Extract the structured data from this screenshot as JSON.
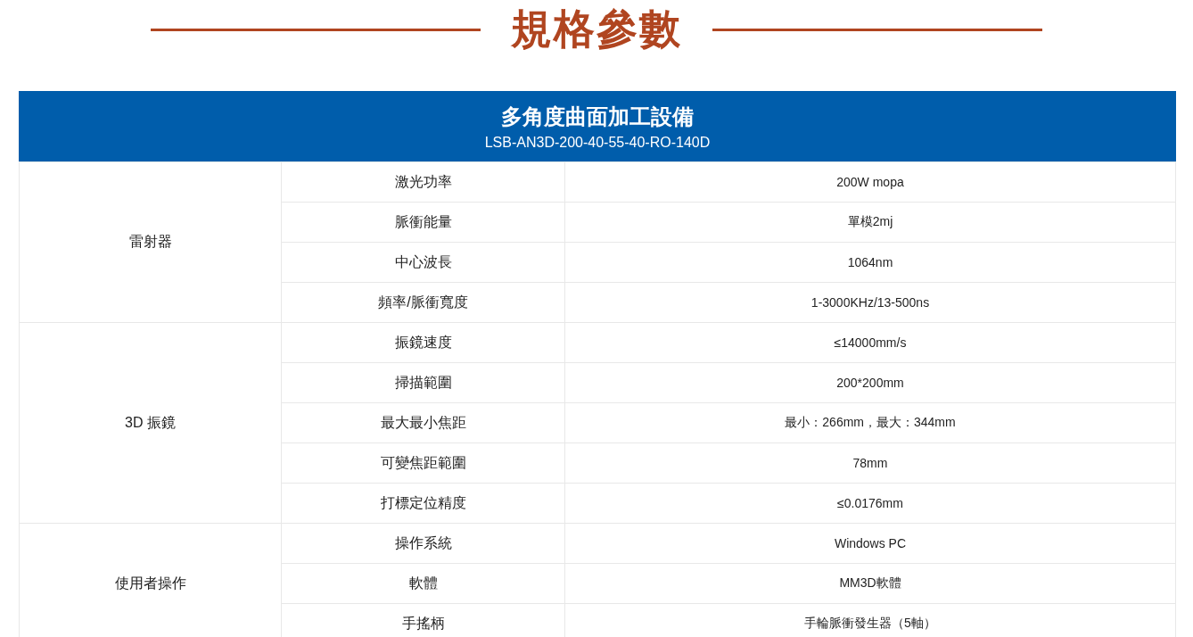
{
  "heading": "規格參數",
  "table": {
    "title": "多角度曲面加工設備",
    "model": "LSB-AN3D-200-40-55-40-RO-140D",
    "groups": [
      {
        "name": "雷射器",
        "rows": [
          {
            "param": "激光功率",
            "value": "200W mopa"
          },
          {
            "param": "脈衝能量",
            "value": "單模2mj"
          },
          {
            "param": "中心波長",
            "value": "1064nm"
          },
          {
            "param": "頻率/脈衝寬度",
            "value": "1-3000KHz/13-500ns"
          }
        ]
      },
      {
        "name": "3D 振鏡",
        "rows": [
          {
            "param": "振鏡速度",
            "value": "≤14000mm/s"
          },
          {
            "param": "掃描範圍",
            "value": "200*200mm"
          },
          {
            "param": "最大最小焦距",
            "value": "最小：266mm，最大：344mm"
          },
          {
            "param": "可變焦距範圍",
            "value": "78mm"
          },
          {
            "param": "打標定位精度",
            "value": "≤0.0176mm"
          }
        ]
      },
      {
        "name": "使用者操作",
        "rows": [
          {
            "param": "操作系統",
            "value": "Windows PC"
          },
          {
            "param": "軟體",
            "value": "MM3D軟體"
          },
          {
            "param": "手搖柄",
            "value": "手輪脈衝發生器（5軸）"
          }
        ]
      }
    ]
  }
}
